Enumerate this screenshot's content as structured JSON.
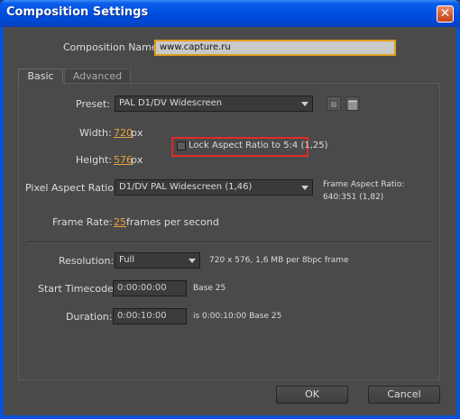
{
  "window": {
    "title": "Composition Settings",
    "close_glyph": "✕"
  },
  "composition_name": {
    "label": "Composition Name:",
    "value": "www.capture.ru"
  },
  "tabs": [
    {
      "label": "Basic"
    },
    {
      "label": "Advanced"
    }
  ],
  "preset": {
    "label": "Preset:",
    "value": "PAL D1/DV Widescreen",
    "icons": [
      "save-preset-icon",
      "trash-icon"
    ]
  },
  "width": {
    "label": "Width:",
    "value": "720",
    "unit": "px"
  },
  "height": {
    "label": "Height:",
    "value": "576",
    "unit": "px"
  },
  "lock_aspect": {
    "label": "Lock Aspect Ratio to 5:4 (1,25)",
    "checked": false
  },
  "pixel_aspect": {
    "label": "Pixel Aspect Ratio:",
    "value": "D1/DV PAL Widescreen (1,46)"
  },
  "frame_aspect": {
    "label": "Frame Aspect Ratio:",
    "value": "640:351 (1,82)"
  },
  "frame_rate": {
    "label": "Frame Rate:",
    "value": "25",
    "unit": "frames per second"
  },
  "resolution": {
    "label": "Resolution:",
    "value": "Full",
    "info": "720 x 576, 1,6 MB per 8bpc frame"
  },
  "start_timecode": {
    "label": "Start Timecode:",
    "value": "0:00:00:00",
    "base": "Base 25"
  },
  "duration": {
    "label": "Duration:",
    "value": "0:00:10:00",
    "info": "is 0:00:10:00  Base 25"
  },
  "buttons": {
    "ok": "OK",
    "cancel": "Cancel"
  },
  "colors": {
    "accent": "#e8a23a",
    "highlight_box": "#e02a2a",
    "title_bar": "#0050e0"
  }
}
